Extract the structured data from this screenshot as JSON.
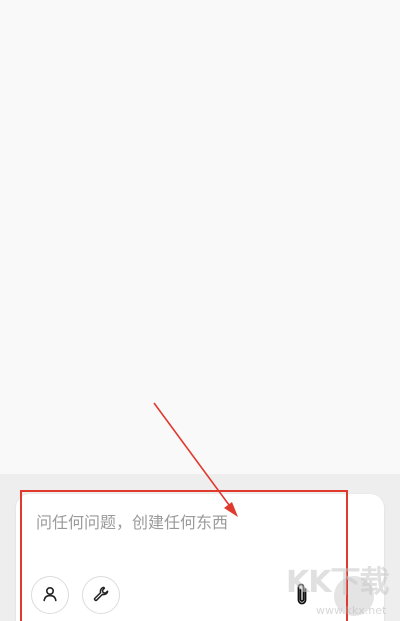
{
  "composer": {
    "placeholder": "问任何问题，创建任何东西",
    "value": ""
  },
  "toolbar": {
    "left_buttons": [
      {
        "icon": "person-icon"
      },
      {
        "icon": "wrench-icon"
      }
    ],
    "right_buttons": [
      {
        "icon": "paperclip-icon"
      },
      {
        "icon": "send-icon"
      }
    ]
  },
  "annotation": {
    "color": "#e03a2f"
  },
  "watermark": {
    "logo_text": "KK下载",
    "url": "www.kkx.net"
  }
}
